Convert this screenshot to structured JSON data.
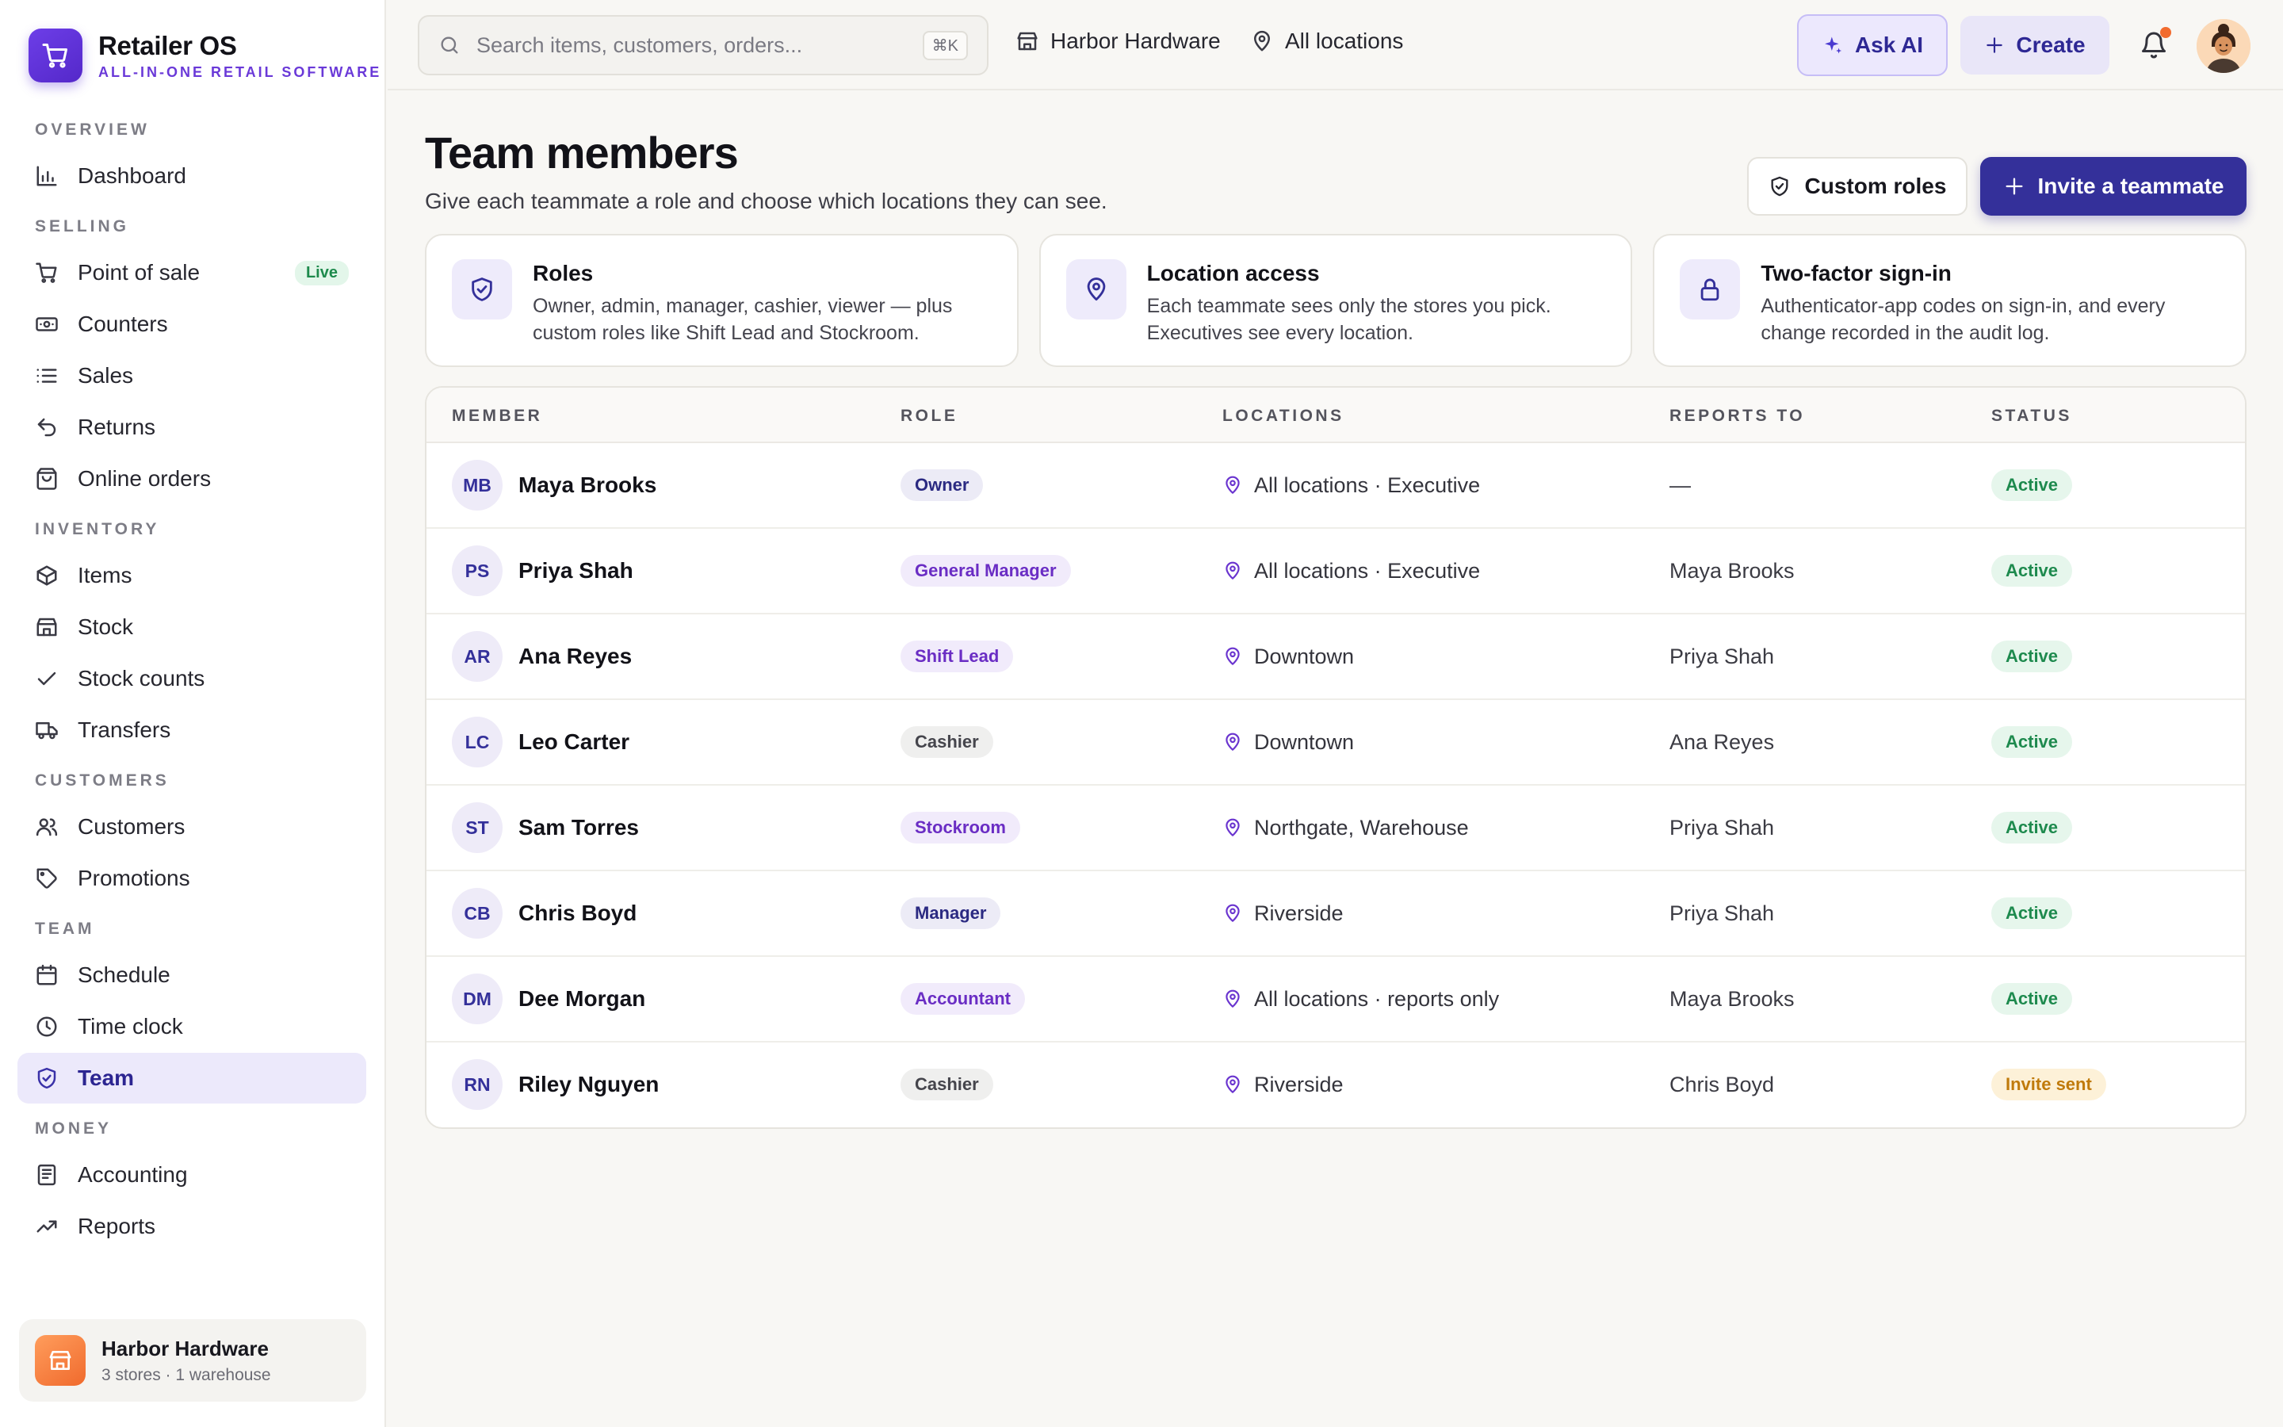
{
  "brand": {
    "name": "Retailer OS",
    "tagline": "ALL-IN-ONE RETAIL SOFTWARE"
  },
  "nav": {
    "overview": "OVERVIEW",
    "dashboard": "Dashboard",
    "selling": "SELLING",
    "point_of_sale": "Point of sale",
    "live_badge": "Live",
    "counters": "Counters",
    "sales": "Sales",
    "returns": "Returns",
    "online_orders": "Online orders",
    "inventory": "INVENTORY",
    "items": "Items",
    "stock": "Stock",
    "stock_counts": "Stock counts",
    "transfers": "Transfers",
    "customers_section": "CUSTOMERS",
    "customers": "Customers",
    "promotions": "Promotions",
    "team_section": "TEAM",
    "schedule": "Schedule",
    "time_clock": "Time clock",
    "team": "Team",
    "money": "MONEY",
    "accounting": "Accounting",
    "reports": "Reports"
  },
  "store_card": {
    "name": "Harbor Hardware",
    "subtitle": "3 stores · 1 warehouse"
  },
  "header": {
    "search_placeholder": "Search items, customers, orders...",
    "search_shortcut": "⌘K",
    "store": "Harbor Hardware",
    "location": "All locations",
    "ask_ai": "Ask AI",
    "create": "Create"
  },
  "page": {
    "title": "Team members",
    "subtitle": "Give each teammate a role and choose which locations they can see.",
    "custom_roles": "Custom roles",
    "invite": "Invite a teammate"
  },
  "info_cards": [
    {
      "title": "Roles",
      "text": "Owner, admin, manager, cashier, viewer — plus custom roles like Shift Lead and Stockroom."
    },
    {
      "title": "Location access",
      "text": "Each teammate sees only the stores you pick. Executives see every location."
    },
    {
      "title": "Two-factor sign-in",
      "text": "Authenticator-app codes on sign-in, and every change recorded in the audit log."
    }
  ],
  "table": {
    "headers": {
      "member": "MEMBER",
      "role": "ROLE",
      "locations": "LOCATIONS",
      "reports_to": "REPORTS TO",
      "status": "STATUS"
    },
    "rows": [
      {
        "initials": "MB",
        "name": "Maya Brooks",
        "role": "Owner",
        "role_tone": "navy",
        "locations": "All locations · Executive",
        "reports_to": "—",
        "status": "Active",
        "status_tone": "active"
      },
      {
        "initials": "PS",
        "name": "Priya Shah",
        "role": "General Manager",
        "role_tone": "purple",
        "locations": "All locations · Executive",
        "reports_to": "Maya Brooks",
        "status": "Active",
        "status_tone": "active"
      },
      {
        "initials": "AR",
        "name": "Ana Reyes",
        "role": "Shift Lead",
        "role_tone": "purple",
        "locations": "Downtown",
        "reports_to": "Priya Shah",
        "status": "Active",
        "status_tone": "active"
      },
      {
        "initials": "LC",
        "name": "Leo Carter",
        "role": "Cashier",
        "role_tone": "gray",
        "locations": "Downtown",
        "reports_to": "Ana Reyes",
        "status": "Active",
        "status_tone": "active"
      },
      {
        "initials": "ST",
        "name": "Sam Torres",
        "role": "Stockroom",
        "role_tone": "purple",
        "locations": "Northgate, Warehouse",
        "reports_to": "Priya Shah",
        "status": "Active",
        "status_tone": "active"
      },
      {
        "initials": "CB",
        "name": "Chris Boyd",
        "role": "Manager",
        "role_tone": "navy",
        "locations": "Riverside",
        "reports_to": "Priya Shah",
        "status": "Active",
        "status_tone": "active"
      },
      {
        "initials": "DM",
        "name": "Dee Morgan",
        "role": "Accountant",
        "role_tone": "purple",
        "locations": "All locations · reports only",
        "reports_to": "Maya Brooks",
        "status": "Active",
        "status_tone": "active"
      },
      {
        "initials": "RN",
        "name": "Riley Nguyen",
        "role": "Cashier",
        "role_tone": "gray",
        "locations": "Riverside",
        "reports_to": "Chris Boyd",
        "status": "Invite sent",
        "status_tone": "invite"
      }
    ]
  },
  "colors": {
    "accent": "#34309a",
    "brand": "#6a39d8",
    "active": "#1e8a4e",
    "invite": "#c07a0b",
    "notification": "#f26b2e"
  }
}
